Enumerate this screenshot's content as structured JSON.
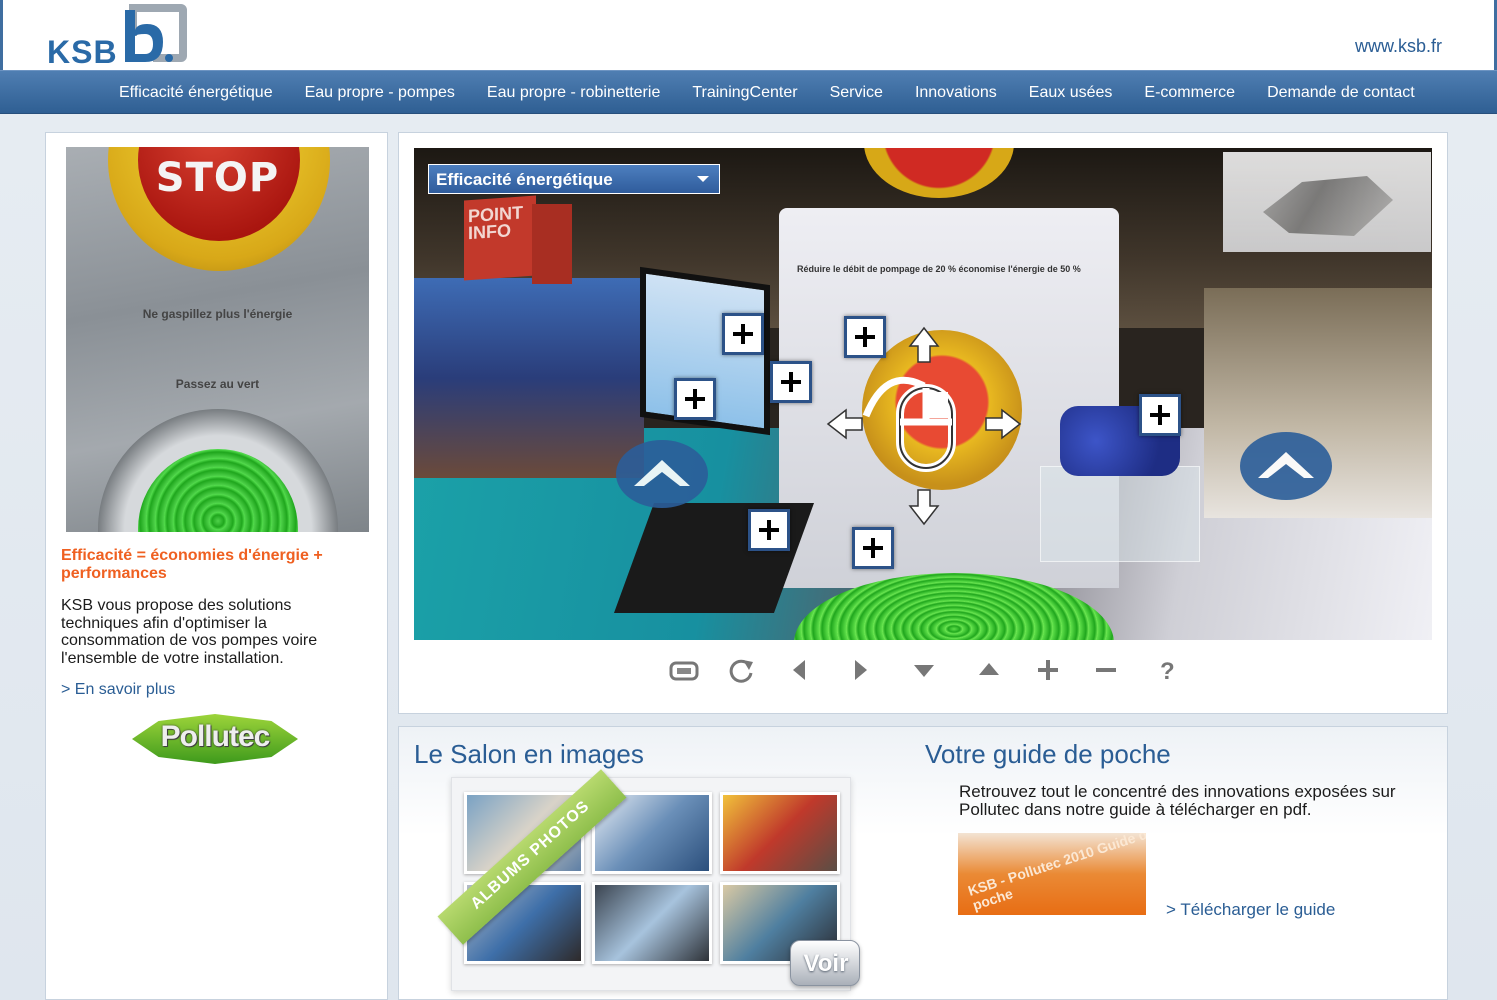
{
  "header": {
    "logo_text": "KSB",
    "site_url": "www.ksb.fr"
  },
  "nav": {
    "items": [
      "Efficacité énergétique",
      "Eau propre - pompes",
      "Eau propre - robinetterie",
      "TrainingCenter",
      "Service",
      "Innovations",
      "Eaux usées",
      "E-commerce",
      "Demande de contact"
    ]
  },
  "promo": {
    "image_stop": "STOP",
    "image_line1": "Ne gaspillez plus l'énergie",
    "image_line2": "Passez au vert",
    "title": "Efficacité = économies d'énergie + performances",
    "body": "KSB vous propose des solutions techniques afin d'optimiser la consommation de vos pompes voire l'ensemble de votre installation.",
    "learn_more": "> En savoir plus",
    "partner_logo": "Pollutec"
  },
  "viewer": {
    "dropdown_value": "Efficacité énergétique",
    "banner_text": "POINT INFO",
    "wall_caption": "Réduire le débit de pompage de 20 % économise l'énergie de 50 %",
    "hotspot_icon": "plus-icon",
    "controls": [
      "fullscreen-icon",
      "rotate-icon",
      "pan-left-icon",
      "pan-right-icon",
      "pan-down-icon",
      "pan-up-icon",
      "zoom-in-icon",
      "zoom-out-icon",
      "help-icon"
    ]
  },
  "gallery": {
    "title": "Le Salon en images",
    "ribbon": "ALBUMS PHOTOS",
    "button": "Voir"
  },
  "guide": {
    "title": "Votre guide de poche",
    "text": "Retrouvez tout le concentré des innovations exposées sur Pollutec dans notre guide à télécharger en pdf.",
    "image_text": "KSB - Pollutec 2010 Guide de poche",
    "download": "> Télécharger le guide"
  },
  "colors": {
    "brand_blue": "#2a5d94",
    "nav_blue": "#3f6ea0",
    "accent_orange": "#ef6021"
  }
}
